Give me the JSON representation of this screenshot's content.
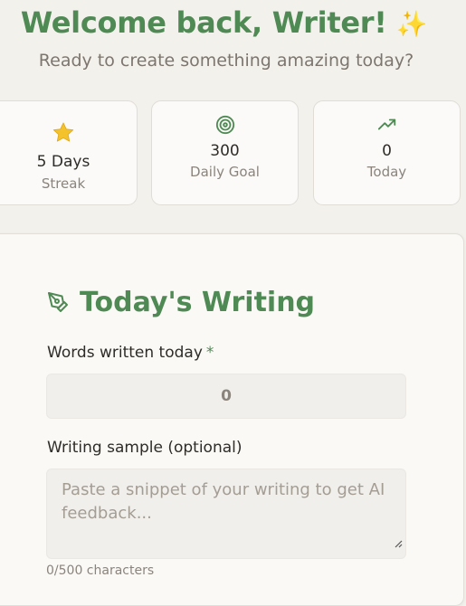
{
  "header": {
    "title": "Welcome back, Writer!",
    "title_emoji": "✨",
    "subtitle": "Ready to create something amazing today?"
  },
  "stats": [
    {
      "icon": "star-icon",
      "value": "5 Days",
      "label": "Streak"
    },
    {
      "icon": "target-icon",
      "value": "300",
      "label": "Daily Goal"
    },
    {
      "icon": "trending-up-icon",
      "value": "0",
      "label": "Today"
    }
  ],
  "writing": {
    "title": "Today's Writing",
    "words_label": "Words written today",
    "required_mark": "*",
    "words_value": "0",
    "sample_label": "Writing sample (optional)",
    "sample_placeholder": "Paste a snippet of your writing to get AI feedback...",
    "char_count": "0/500 characters"
  },
  "colors": {
    "accent": "#4f8a54",
    "star": "#f4c22b",
    "background": "#f3f1ec"
  }
}
